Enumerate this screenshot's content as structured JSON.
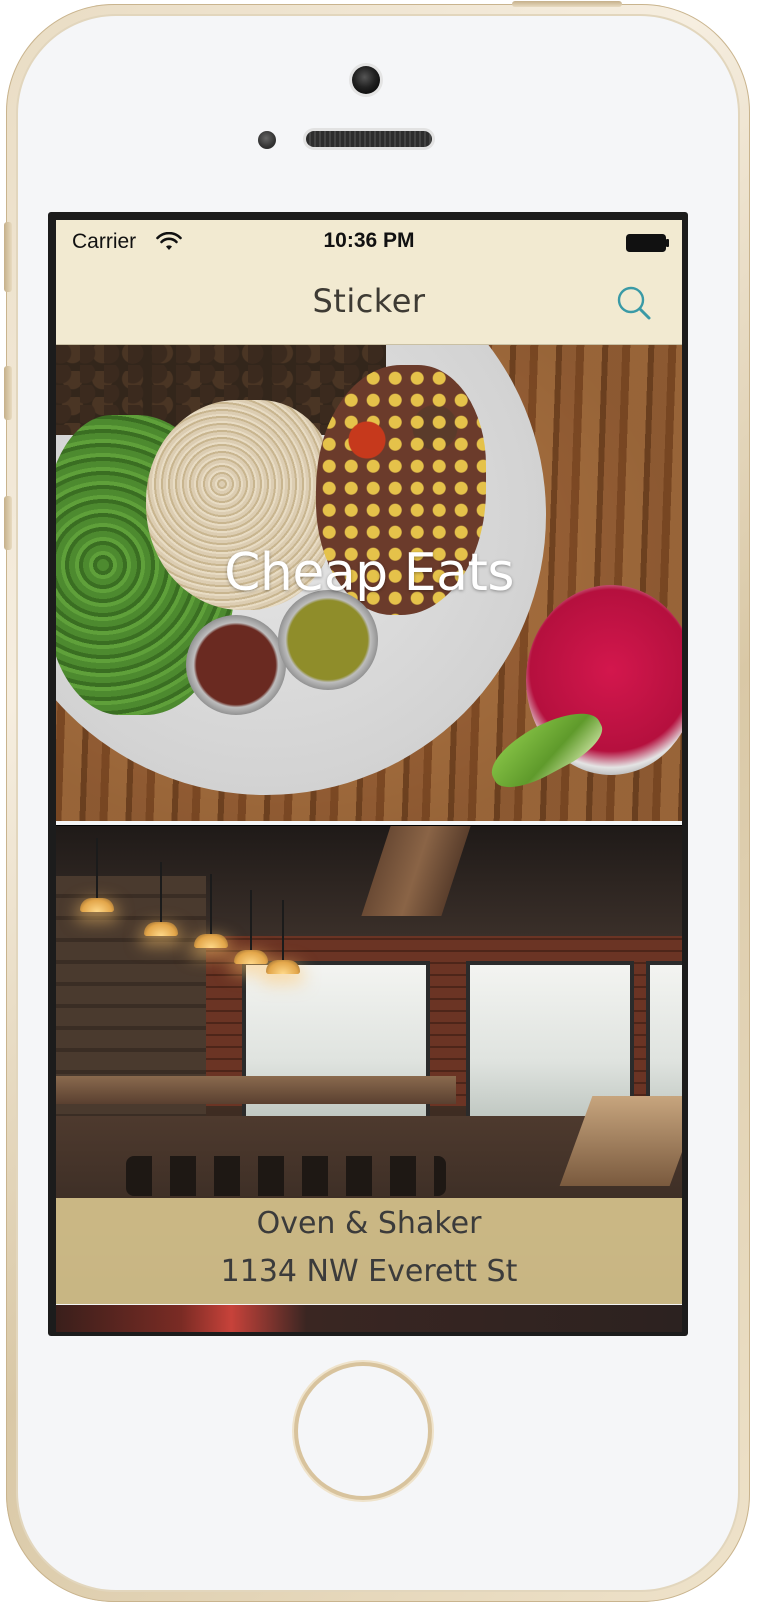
{
  "status_bar": {
    "carrier": "Carrier",
    "time": "10:36 PM",
    "wifi_icon": "wifi-icon",
    "battery_icon": "battery-icon"
  },
  "nav": {
    "title": "Sticker",
    "search_icon": "search-icon",
    "background": "#f2ead1",
    "accent": "#3a9aa6"
  },
  "feed": {
    "category_card": {
      "title": "Cheap Eats",
      "image": "food-bowl-photo"
    },
    "restaurant_card": {
      "name": "Oven & Shaker",
      "address": "1134 NW Everett St",
      "image": "restaurant-interior-photo",
      "caption_color": "#decb92"
    }
  }
}
